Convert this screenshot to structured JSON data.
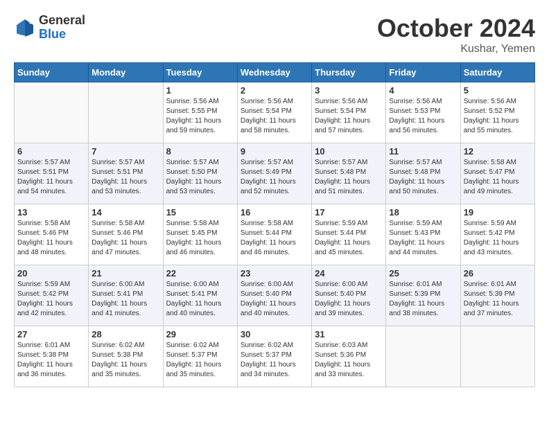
{
  "header": {
    "logo": {
      "general": "General",
      "blue": "Blue"
    },
    "title": "October 2024",
    "location": "Kushar, Yemen"
  },
  "calendar": {
    "days_of_week": [
      "Sunday",
      "Monday",
      "Tuesday",
      "Wednesday",
      "Thursday",
      "Friday",
      "Saturday"
    ],
    "weeks": [
      [
        {
          "day": "",
          "sunrise": "",
          "sunset": "",
          "daylight": ""
        },
        {
          "day": "",
          "sunrise": "",
          "sunset": "",
          "daylight": ""
        },
        {
          "day": "1",
          "sunrise": "Sunrise: 5:56 AM",
          "sunset": "Sunset: 5:55 PM",
          "daylight": "Daylight: 11 hours and 59 minutes."
        },
        {
          "day": "2",
          "sunrise": "Sunrise: 5:56 AM",
          "sunset": "Sunset: 5:54 PM",
          "daylight": "Daylight: 11 hours and 58 minutes."
        },
        {
          "day": "3",
          "sunrise": "Sunrise: 5:56 AM",
          "sunset": "Sunset: 5:54 PM",
          "daylight": "Daylight: 11 hours and 57 minutes."
        },
        {
          "day": "4",
          "sunrise": "Sunrise: 5:56 AM",
          "sunset": "Sunset: 5:53 PM",
          "daylight": "Daylight: 11 hours and 56 minutes."
        },
        {
          "day": "5",
          "sunrise": "Sunrise: 5:56 AM",
          "sunset": "Sunset: 5:52 PM",
          "daylight": "Daylight: 11 hours and 55 minutes."
        }
      ],
      [
        {
          "day": "6",
          "sunrise": "Sunrise: 5:57 AM",
          "sunset": "Sunset: 5:51 PM",
          "daylight": "Daylight: 11 hours and 54 minutes."
        },
        {
          "day": "7",
          "sunrise": "Sunrise: 5:57 AM",
          "sunset": "Sunset: 5:51 PM",
          "daylight": "Daylight: 11 hours and 53 minutes."
        },
        {
          "day": "8",
          "sunrise": "Sunrise: 5:57 AM",
          "sunset": "Sunset: 5:50 PM",
          "daylight": "Daylight: 11 hours and 53 minutes."
        },
        {
          "day": "9",
          "sunrise": "Sunrise: 5:57 AM",
          "sunset": "Sunset: 5:49 PM",
          "daylight": "Daylight: 11 hours and 52 minutes."
        },
        {
          "day": "10",
          "sunrise": "Sunrise: 5:57 AM",
          "sunset": "Sunset: 5:48 PM",
          "daylight": "Daylight: 11 hours and 51 minutes."
        },
        {
          "day": "11",
          "sunrise": "Sunrise: 5:57 AM",
          "sunset": "Sunset: 5:48 PM",
          "daylight": "Daylight: 11 hours and 50 minutes."
        },
        {
          "day": "12",
          "sunrise": "Sunrise: 5:58 AM",
          "sunset": "Sunset: 5:47 PM",
          "daylight": "Daylight: 11 hours and 49 minutes."
        }
      ],
      [
        {
          "day": "13",
          "sunrise": "Sunrise: 5:58 AM",
          "sunset": "Sunset: 5:46 PM",
          "daylight": "Daylight: 11 hours and 48 minutes."
        },
        {
          "day": "14",
          "sunrise": "Sunrise: 5:58 AM",
          "sunset": "Sunset: 5:46 PM",
          "daylight": "Daylight: 11 hours and 47 minutes."
        },
        {
          "day": "15",
          "sunrise": "Sunrise: 5:58 AM",
          "sunset": "Sunset: 5:45 PM",
          "daylight": "Daylight: 11 hours and 46 minutes."
        },
        {
          "day": "16",
          "sunrise": "Sunrise: 5:58 AM",
          "sunset": "Sunset: 5:44 PM",
          "daylight": "Daylight: 11 hours and 46 minutes."
        },
        {
          "day": "17",
          "sunrise": "Sunrise: 5:59 AM",
          "sunset": "Sunset: 5:44 PM",
          "daylight": "Daylight: 11 hours and 45 minutes."
        },
        {
          "day": "18",
          "sunrise": "Sunrise: 5:59 AM",
          "sunset": "Sunset: 5:43 PM",
          "daylight": "Daylight: 11 hours and 44 minutes."
        },
        {
          "day": "19",
          "sunrise": "Sunrise: 5:59 AM",
          "sunset": "Sunset: 5:42 PM",
          "daylight": "Daylight: 11 hours and 43 minutes."
        }
      ],
      [
        {
          "day": "20",
          "sunrise": "Sunrise: 5:59 AM",
          "sunset": "Sunset: 5:42 PM",
          "daylight": "Daylight: 11 hours and 42 minutes."
        },
        {
          "day": "21",
          "sunrise": "Sunrise: 6:00 AM",
          "sunset": "Sunset: 5:41 PM",
          "daylight": "Daylight: 11 hours and 41 minutes."
        },
        {
          "day": "22",
          "sunrise": "Sunrise: 6:00 AM",
          "sunset": "Sunset: 5:41 PM",
          "daylight": "Daylight: 11 hours and 40 minutes."
        },
        {
          "day": "23",
          "sunrise": "Sunrise: 6:00 AM",
          "sunset": "Sunset: 5:40 PM",
          "daylight": "Daylight: 11 hours and 40 minutes."
        },
        {
          "day": "24",
          "sunrise": "Sunrise: 6:00 AM",
          "sunset": "Sunset: 5:40 PM",
          "daylight": "Daylight: 11 hours and 39 minutes."
        },
        {
          "day": "25",
          "sunrise": "Sunrise: 6:01 AM",
          "sunset": "Sunset: 5:39 PM",
          "daylight": "Daylight: 11 hours and 38 minutes."
        },
        {
          "day": "26",
          "sunrise": "Sunrise: 6:01 AM",
          "sunset": "Sunset: 5:39 PM",
          "daylight": "Daylight: 11 hours and 37 minutes."
        }
      ],
      [
        {
          "day": "27",
          "sunrise": "Sunrise: 6:01 AM",
          "sunset": "Sunset: 5:38 PM",
          "daylight": "Daylight: 11 hours and 36 minutes."
        },
        {
          "day": "28",
          "sunrise": "Sunrise: 6:02 AM",
          "sunset": "Sunset: 5:38 PM",
          "daylight": "Daylight: 11 hours and 35 minutes."
        },
        {
          "day": "29",
          "sunrise": "Sunrise: 6:02 AM",
          "sunset": "Sunset: 5:37 PM",
          "daylight": "Daylight: 11 hours and 35 minutes."
        },
        {
          "day": "30",
          "sunrise": "Sunrise: 6:02 AM",
          "sunset": "Sunset: 5:37 PM",
          "daylight": "Daylight: 11 hours and 34 minutes."
        },
        {
          "day": "31",
          "sunrise": "Sunrise: 6:03 AM",
          "sunset": "Sunset: 5:36 PM",
          "daylight": "Daylight: 11 hours and 33 minutes."
        },
        {
          "day": "",
          "sunrise": "",
          "sunset": "",
          "daylight": ""
        },
        {
          "day": "",
          "sunrise": "",
          "sunset": "",
          "daylight": ""
        }
      ]
    ]
  }
}
